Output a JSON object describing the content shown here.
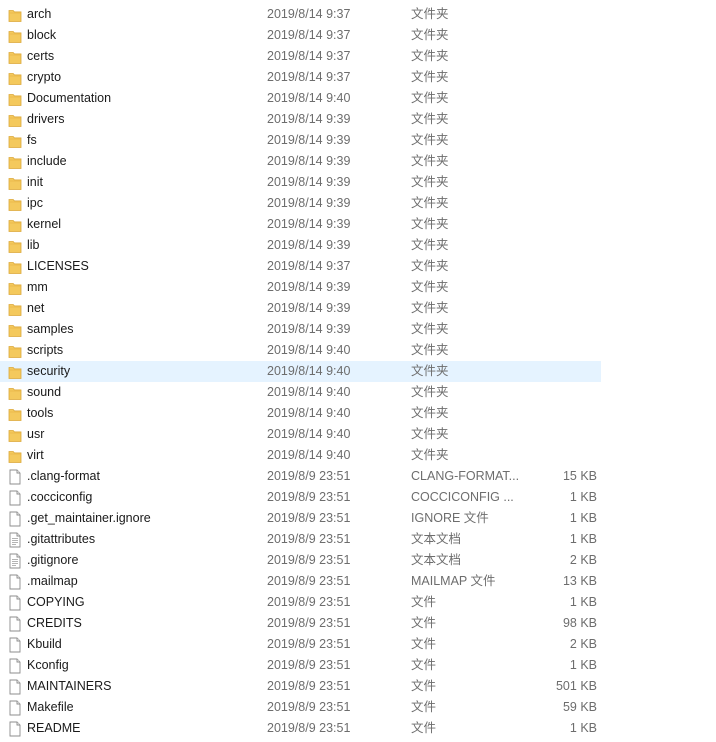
{
  "colors": {
    "selected_row": "#e5f3ff",
    "folder_icon": "#f4c95d",
    "secondary_text": "#6d6d6d"
  },
  "files": [
    {
      "name": "arch",
      "modified": "2019/8/14 9:37",
      "type": "文件夹",
      "size": "",
      "icon": "folder-icon",
      "selected": false
    },
    {
      "name": "block",
      "modified": "2019/8/14 9:37",
      "type": "文件夹",
      "size": "",
      "icon": "folder-icon",
      "selected": false
    },
    {
      "name": "certs",
      "modified": "2019/8/14 9:37",
      "type": "文件夹",
      "size": "",
      "icon": "folder-icon",
      "selected": false
    },
    {
      "name": "crypto",
      "modified": "2019/8/14 9:37",
      "type": "文件夹",
      "size": "",
      "icon": "folder-icon",
      "selected": false
    },
    {
      "name": "Documentation",
      "modified": "2019/8/14 9:40",
      "type": "文件夹",
      "size": "",
      "icon": "folder-icon",
      "selected": false
    },
    {
      "name": "drivers",
      "modified": "2019/8/14 9:39",
      "type": "文件夹",
      "size": "",
      "icon": "folder-icon",
      "selected": false
    },
    {
      "name": "fs",
      "modified": "2019/8/14 9:39",
      "type": "文件夹",
      "size": "",
      "icon": "folder-icon",
      "selected": false
    },
    {
      "name": "include",
      "modified": "2019/8/14 9:39",
      "type": "文件夹",
      "size": "",
      "icon": "folder-icon",
      "selected": false
    },
    {
      "name": "init",
      "modified": "2019/8/14 9:39",
      "type": "文件夹",
      "size": "",
      "icon": "folder-icon",
      "selected": false
    },
    {
      "name": "ipc",
      "modified": "2019/8/14 9:39",
      "type": "文件夹",
      "size": "",
      "icon": "folder-icon",
      "selected": false
    },
    {
      "name": "kernel",
      "modified": "2019/8/14 9:39",
      "type": "文件夹",
      "size": "",
      "icon": "folder-icon",
      "selected": false
    },
    {
      "name": "lib",
      "modified": "2019/8/14 9:39",
      "type": "文件夹",
      "size": "",
      "icon": "folder-icon",
      "selected": false
    },
    {
      "name": "LICENSES",
      "modified": "2019/8/14 9:37",
      "type": "文件夹",
      "size": "",
      "icon": "folder-icon",
      "selected": false
    },
    {
      "name": "mm",
      "modified": "2019/8/14 9:39",
      "type": "文件夹",
      "size": "",
      "icon": "folder-icon",
      "selected": false
    },
    {
      "name": "net",
      "modified": "2019/8/14 9:39",
      "type": "文件夹",
      "size": "",
      "icon": "folder-icon",
      "selected": false
    },
    {
      "name": "samples",
      "modified": "2019/8/14 9:39",
      "type": "文件夹",
      "size": "",
      "icon": "folder-icon",
      "selected": false
    },
    {
      "name": "scripts",
      "modified": "2019/8/14 9:40",
      "type": "文件夹",
      "size": "",
      "icon": "folder-icon",
      "selected": false
    },
    {
      "name": "security",
      "modified": "2019/8/14 9:40",
      "type": "文件夹",
      "size": "",
      "icon": "folder-icon",
      "selected": true
    },
    {
      "name": "sound",
      "modified": "2019/8/14 9:40",
      "type": "文件夹",
      "size": "",
      "icon": "folder-icon",
      "selected": false
    },
    {
      "name": "tools",
      "modified": "2019/8/14 9:40",
      "type": "文件夹",
      "size": "",
      "icon": "folder-icon",
      "selected": false
    },
    {
      "name": "usr",
      "modified": "2019/8/14 9:40",
      "type": "文件夹",
      "size": "",
      "icon": "folder-icon",
      "selected": false
    },
    {
      "name": "virt",
      "modified": "2019/8/14 9:40",
      "type": "文件夹",
      "size": "",
      "icon": "folder-icon",
      "selected": false
    },
    {
      "name": ".clang-format",
      "modified": "2019/8/9 23:51",
      "type": "CLANG-FORMAT...",
      "size": "15 KB",
      "icon": "file-icon",
      "selected": false
    },
    {
      "name": ".cocciconfig",
      "modified": "2019/8/9 23:51",
      "type": "COCCICONFIG ...",
      "size": "1 KB",
      "icon": "file-icon",
      "selected": false
    },
    {
      "name": ".get_maintainer.ignore",
      "modified": "2019/8/9 23:51",
      "type": "IGNORE 文件",
      "size": "1 KB",
      "icon": "file-icon",
      "selected": false
    },
    {
      "name": ".gitattributes",
      "modified": "2019/8/9 23:51",
      "type": "文本文档",
      "size": "1 KB",
      "icon": "text-file-icon",
      "selected": false
    },
    {
      "name": ".gitignore",
      "modified": "2019/8/9 23:51",
      "type": "文本文档",
      "size": "2 KB",
      "icon": "text-file-icon",
      "selected": false
    },
    {
      "name": ".mailmap",
      "modified": "2019/8/9 23:51",
      "type": "MAILMAP 文件",
      "size": "13 KB",
      "icon": "file-icon",
      "selected": false
    },
    {
      "name": "COPYING",
      "modified": "2019/8/9 23:51",
      "type": "文件",
      "size": "1 KB",
      "icon": "file-icon",
      "selected": false
    },
    {
      "name": "CREDITS",
      "modified": "2019/8/9 23:51",
      "type": "文件",
      "size": "98 KB",
      "icon": "file-icon",
      "selected": false
    },
    {
      "name": "Kbuild",
      "modified": "2019/8/9 23:51",
      "type": "文件",
      "size": "2 KB",
      "icon": "file-icon",
      "selected": false
    },
    {
      "name": "Kconfig",
      "modified": "2019/8/9 23:51",
      "type": "文件",
      "size": "1 KB",
      "icon": "file-icon",
      "selected": false
    },
    {
      "name": "MAINTAINERS",
      "modified": "2019/8/9 23:51",
      "type": "文件",
      "size": "501 KB",
      "icon": "file-icon",
      "selected": false
    },
    {
      "name": "Makefile",
      "modified": "2019/8/9 23:51",
      "type": "文件",
      "size": "59 KB",
      "icon": "file-icon",
      "selected": false
    },
    {
      "name": "README",
      "modified": "2019/8/9 23:51",
      "type": "文件",
      "size": "1 KB",
      "icon": "file-icon",
      "selected": false
    }
  ]
}
